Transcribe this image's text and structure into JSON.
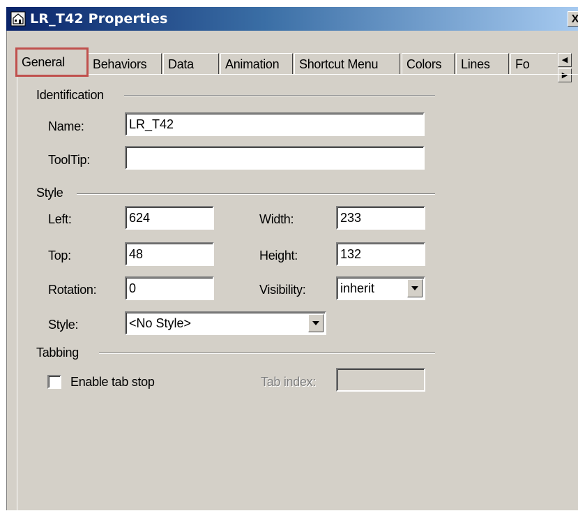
{
  "window": {
    "title": "LR_T42 Properties",
    "close_label": "X"
  },
  "tabs": [
    "General",
    "Behaviors",
    "Data",
    "Animation",
    "Shortcut Menu",
    "Colors",
    "Lines",
    "Fo"
  ],
  "active_tab": "General",
  "identification": {
    "title": "Identification",
    "name_label": "Name:",
    "name_value": "LR_T42",
    "tooltip_label": "ToolTip:",
    "tooltip_value": ""
  },
  "style": {
    "title": "Style",
    "left_label": "Left:",
    "left_value": "624",
    "width_label": "Width:",
    "width_value": "233",
    "top_label": "Top:",
    "top_value": "48",
    "height_label": "Height:",
    "height_value": "132",
    "rotation_label": "Rotation:",
    "rotation_value": "0",
    "visibility_label": "Visibility:",
    "visibility_value": "inherit",
    "style_label": "Style:",
    "style_value": "<No Style>"
  },
  "tabbing": {
    "title": "Tabbing",
    "enable_label": "Enable tab stop",
    "enable_checked": false,
    "tab_index_label": "Tab index:",
    "tab_index_value": ""
  },
  "colors": {
    "highlight": "#c0504d",
    "dialog_bg": "#d4d0c8",
    "titlebar_start": "#0a246a"
  }
}
